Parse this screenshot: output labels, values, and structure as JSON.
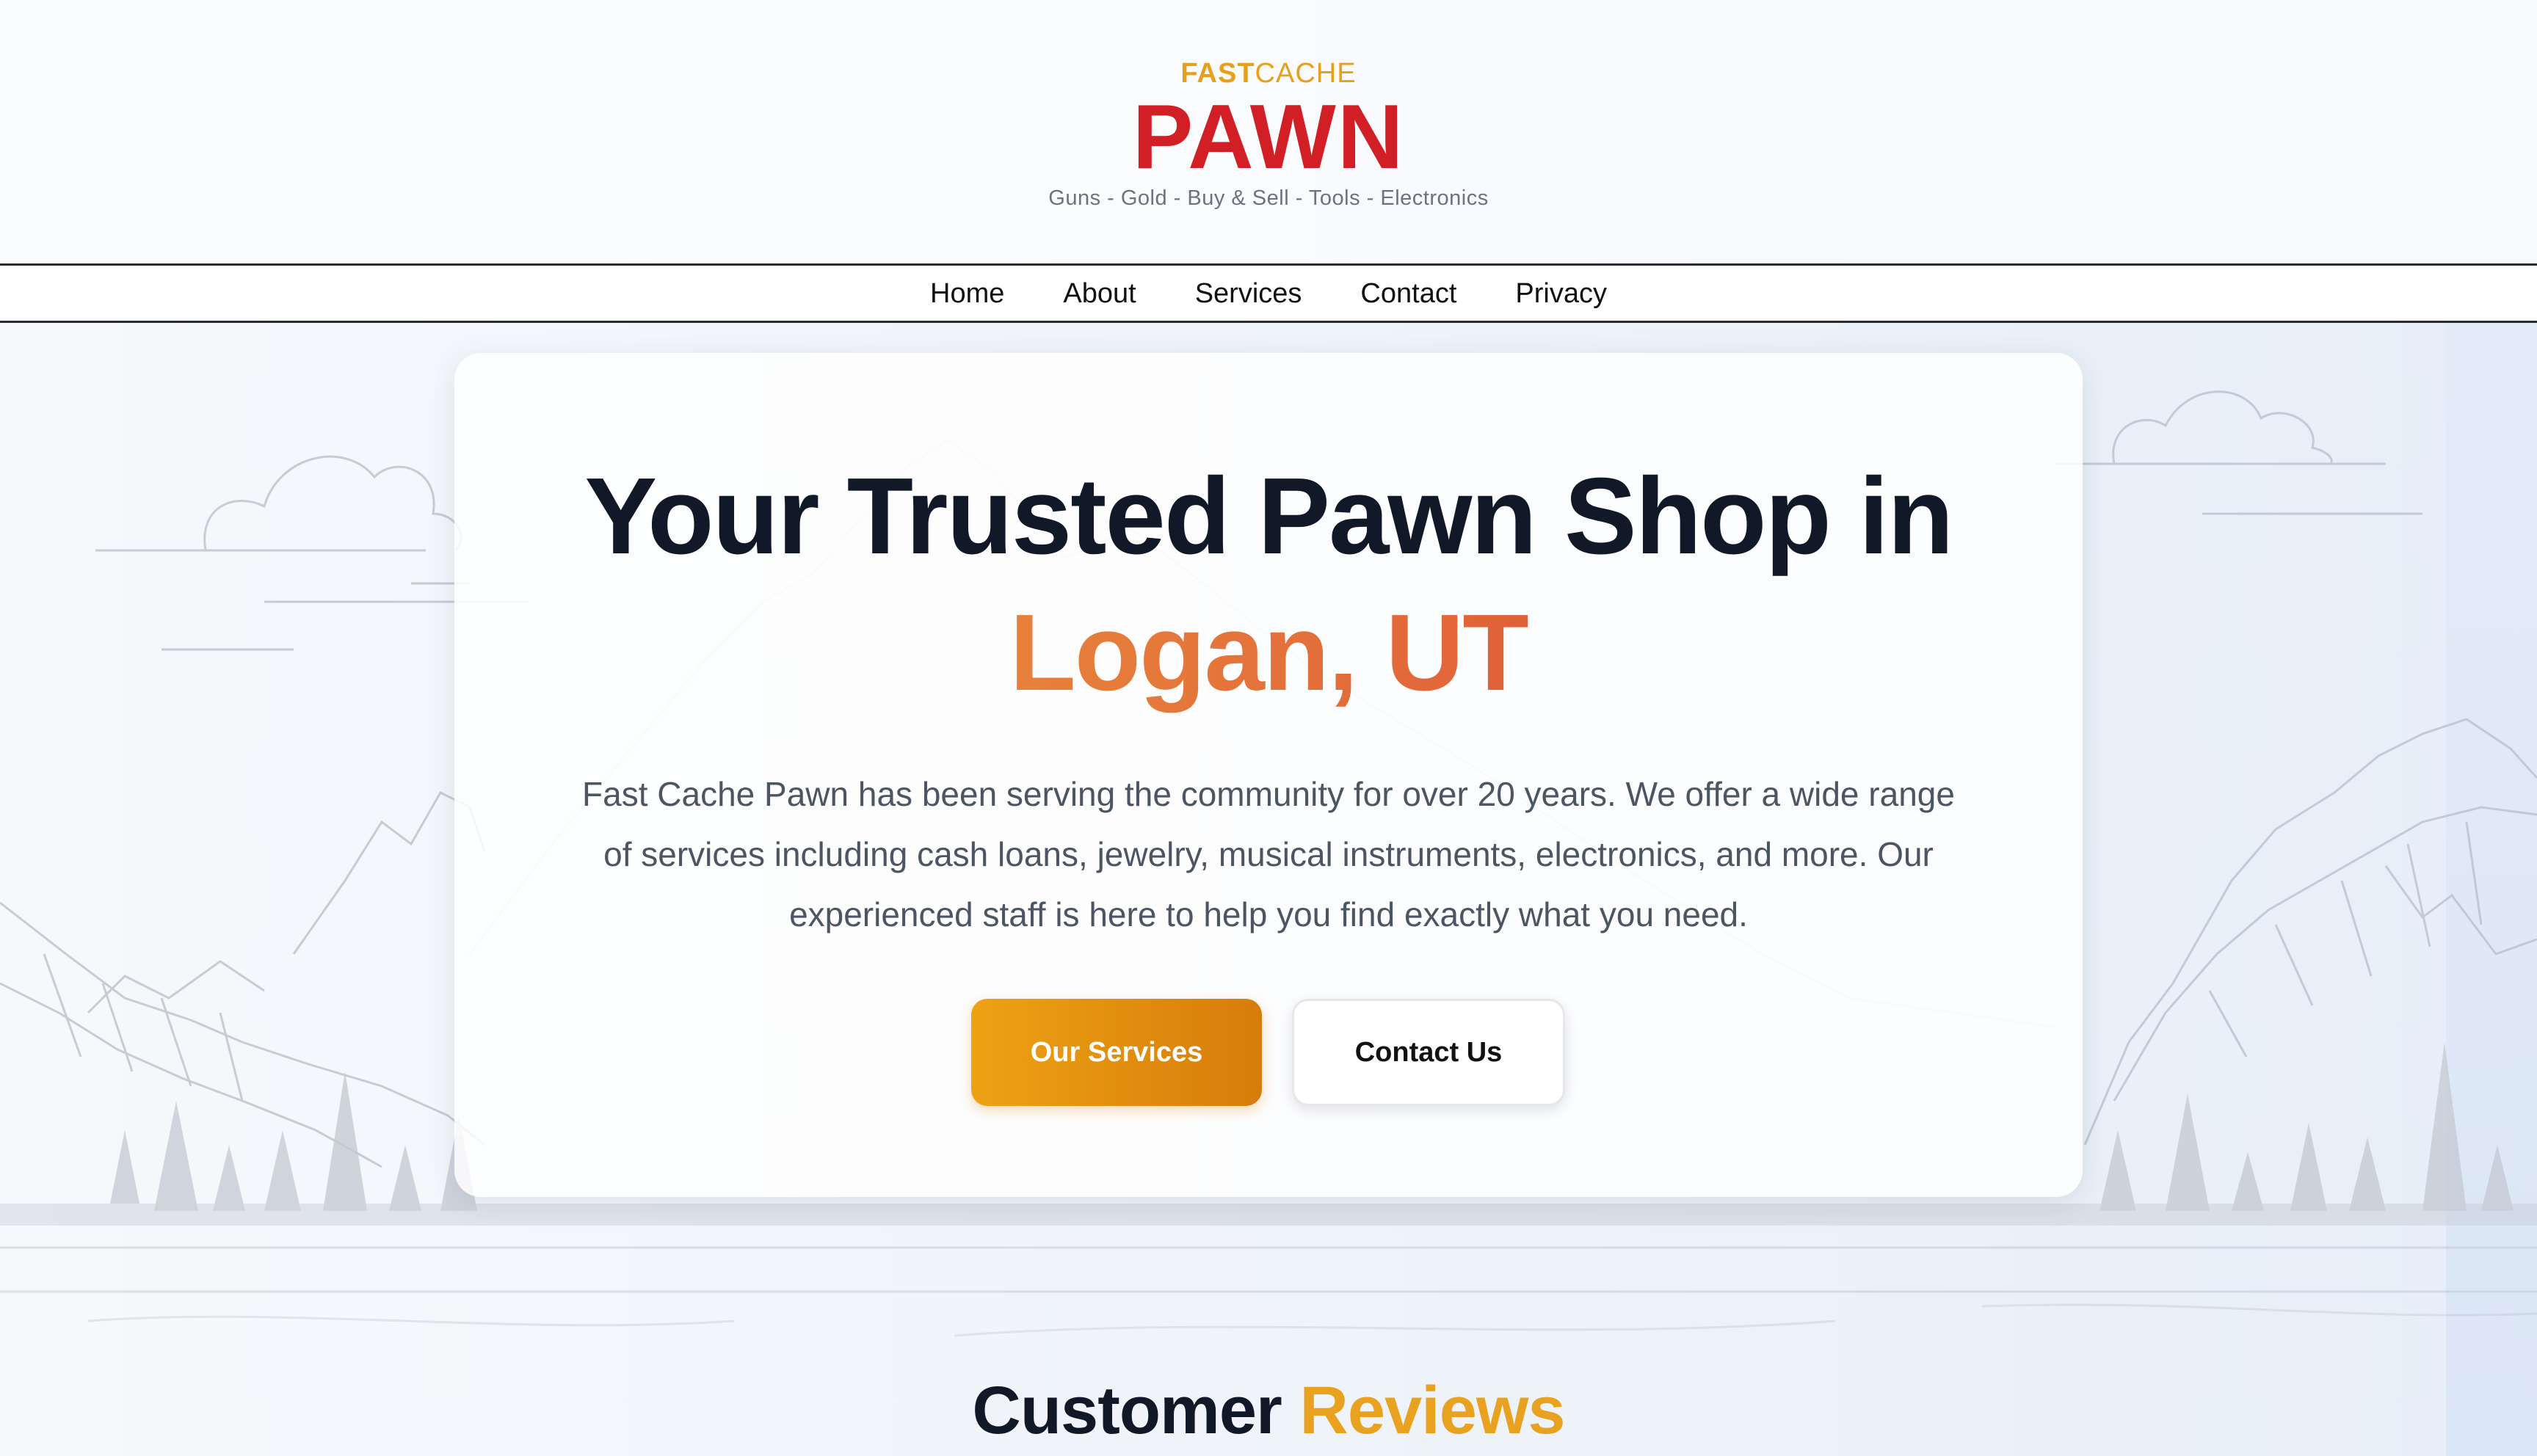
{
  "brand": {
    "top_bold": "FAST",
    "top_light": "CACHE",
    "name": "PAWN",
    "tagline": "Guns - Gold - Buy & Sell - Tools - Electronics"
  },
  "nav": {
    "items": [
      {
        "label": "Home"
      },
      {
        "label": "About"
      },
      {
        "label": "Services"
      },
      {
        "label": "Contact"
      },
      {
        "label": "Privacy"
      }
    ]
  },
  "hero": {
    "title_line1": "Your Trusted Pawn Shop in",
    "title_line2": "Logan, UT",
    "description": "Fast Cache Pawn has been serving the community for over 20 years. We offer a wide range of services including cash loans, jewelry, musical instruments, electronics, and more. Our experienced staff is here to help you find exactly what you need.",
    "primary_button": "Our Services",
    "secondary_button": "Contact Us"
  },
  "reviews": {
    "title_plain": "Customer",
    "title_accent": "Reviews"
  },
  "colors": {
    "brand_red": "#d21f26",
    "brand_gold": "#e6a019",
    "button_orange": "#e6920f",
    "text_dark": "#111827"
  }
}
